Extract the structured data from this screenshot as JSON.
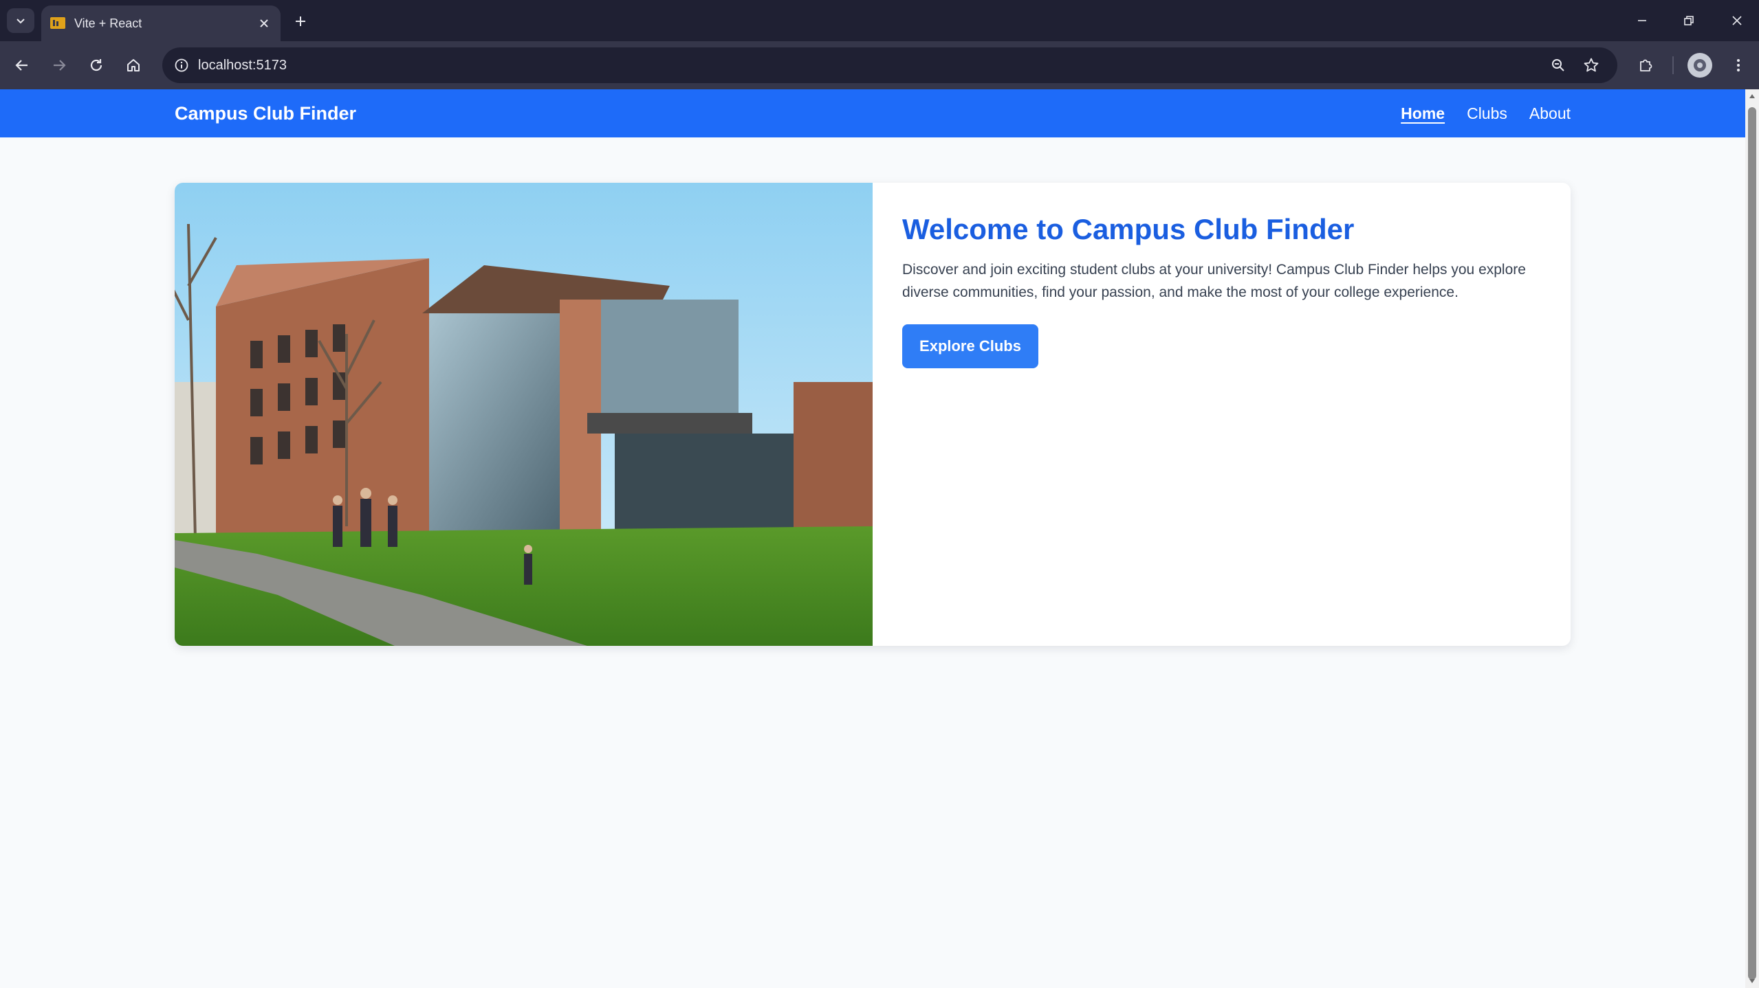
{
  "browser": {
    "tab_title": "Vite + React",
    "url": "localhost:5173",
    "icons": {
      "tab_list": "chevron-down-icon",
      "tab_close": "close-icon",
      "new_tab": "plus-icon",
      "minimize": "minimize-icon",
      "restore": "restore-icon",
      "close_window": "close-icon",
      "back": "arrow-left-icon",
      "forward": "arrow-right-icon",
      "reload": "reload-icon",
      "home": "home-icon",
      "site_info": "info-icon",
      "zoom": "zoom-icon",
      "bookmark": "star-icon",
      "extensions": "puzzle-icon",
      "profile": "profile-icon",
      "menu": "kebab-menu-icon"
    }
  },
  "navbar": {
    "brand": "Campus Club Finder",
    "links": [
      "Home",
      "Clubs",
      "About"
    ],
    "active": "Home"
  },
  "hero": {
    "title": "Welcome to Campus Club Finder",
    "description": "Discover and join exciting student clubs at your university! Campus Club Finder helps you explore diverse communities, find your passion, and make the most of your college experience.",
    "cta_label": "Explore Clubs",
    "image_alt": "campus-building-photo"
  },
  "colors": {
    "nav_bg": "#1e6bf9",
    "title": "#1a5ee0",
    "button": "#2f7df6",
    "page_bg": "#f8fafc",
    "browser_dark": "#1f2033",
    "browser_mid": "#35364a"
  }
}
